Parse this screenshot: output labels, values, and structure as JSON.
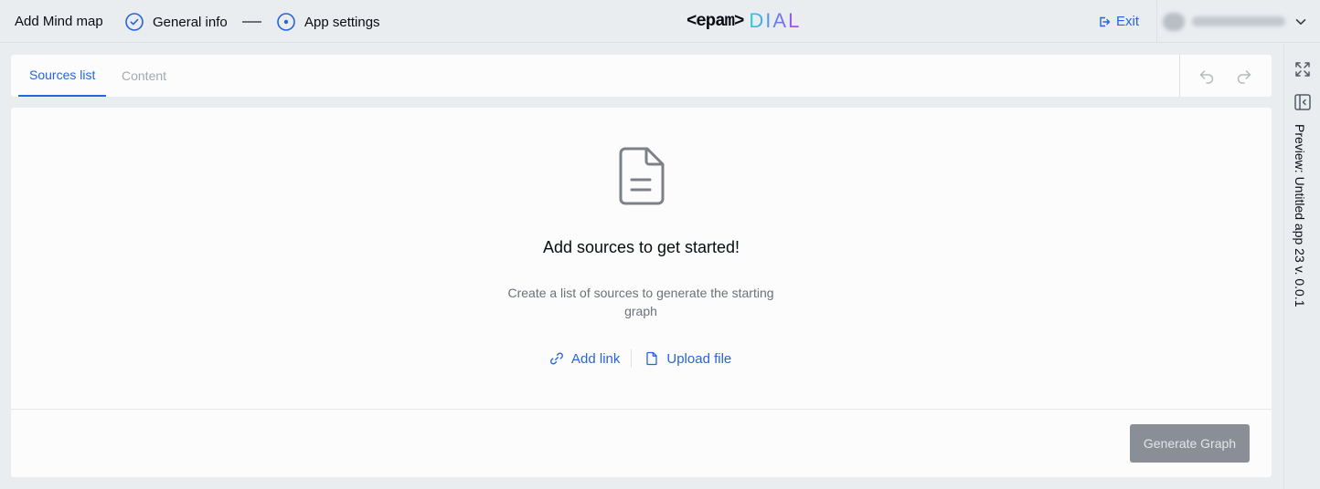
{
  "header": {
    "title": "Add Mind map",
    "steps": [
      {
        "label": "General info",
        "state": "completed"
      },
      {
        "label": "App settings",
        "state": "current"
      }
    ],
    "logo": {
      "left": "<epam>",
      "right": "DIAL"
    },
    "exit_label": "Exit"
  },
  "tabs": [
    {
      "label": "Sources list",
      "active": true
    },
    {
      "label": "Content",
      "active": false
    }
  ],
  "toolbar": {
    "undo_icon": "undo-icon",
    "redo_icon": "redo-icon"
  },
  "empty_state": {
    "icon": "document-icon",
    "title": "Add sources to get started!",
    "description": "Create a list of sources to generate the starting graph",
    "add_link_label": "Add link",
    "upload_file_label": "Upload file"
  },
  "generate_button_label": "Generate Graph",
  "preview": {
    "label": "Preview: Untitled app 23 v. 0.0.1"
  },
  "colors": {
    "accent": "#2764d9",
    "background": "#eaedf0",
    "panel": "#fcfcfc",
    "disabled_button": "#8a8f97"
  }
}
